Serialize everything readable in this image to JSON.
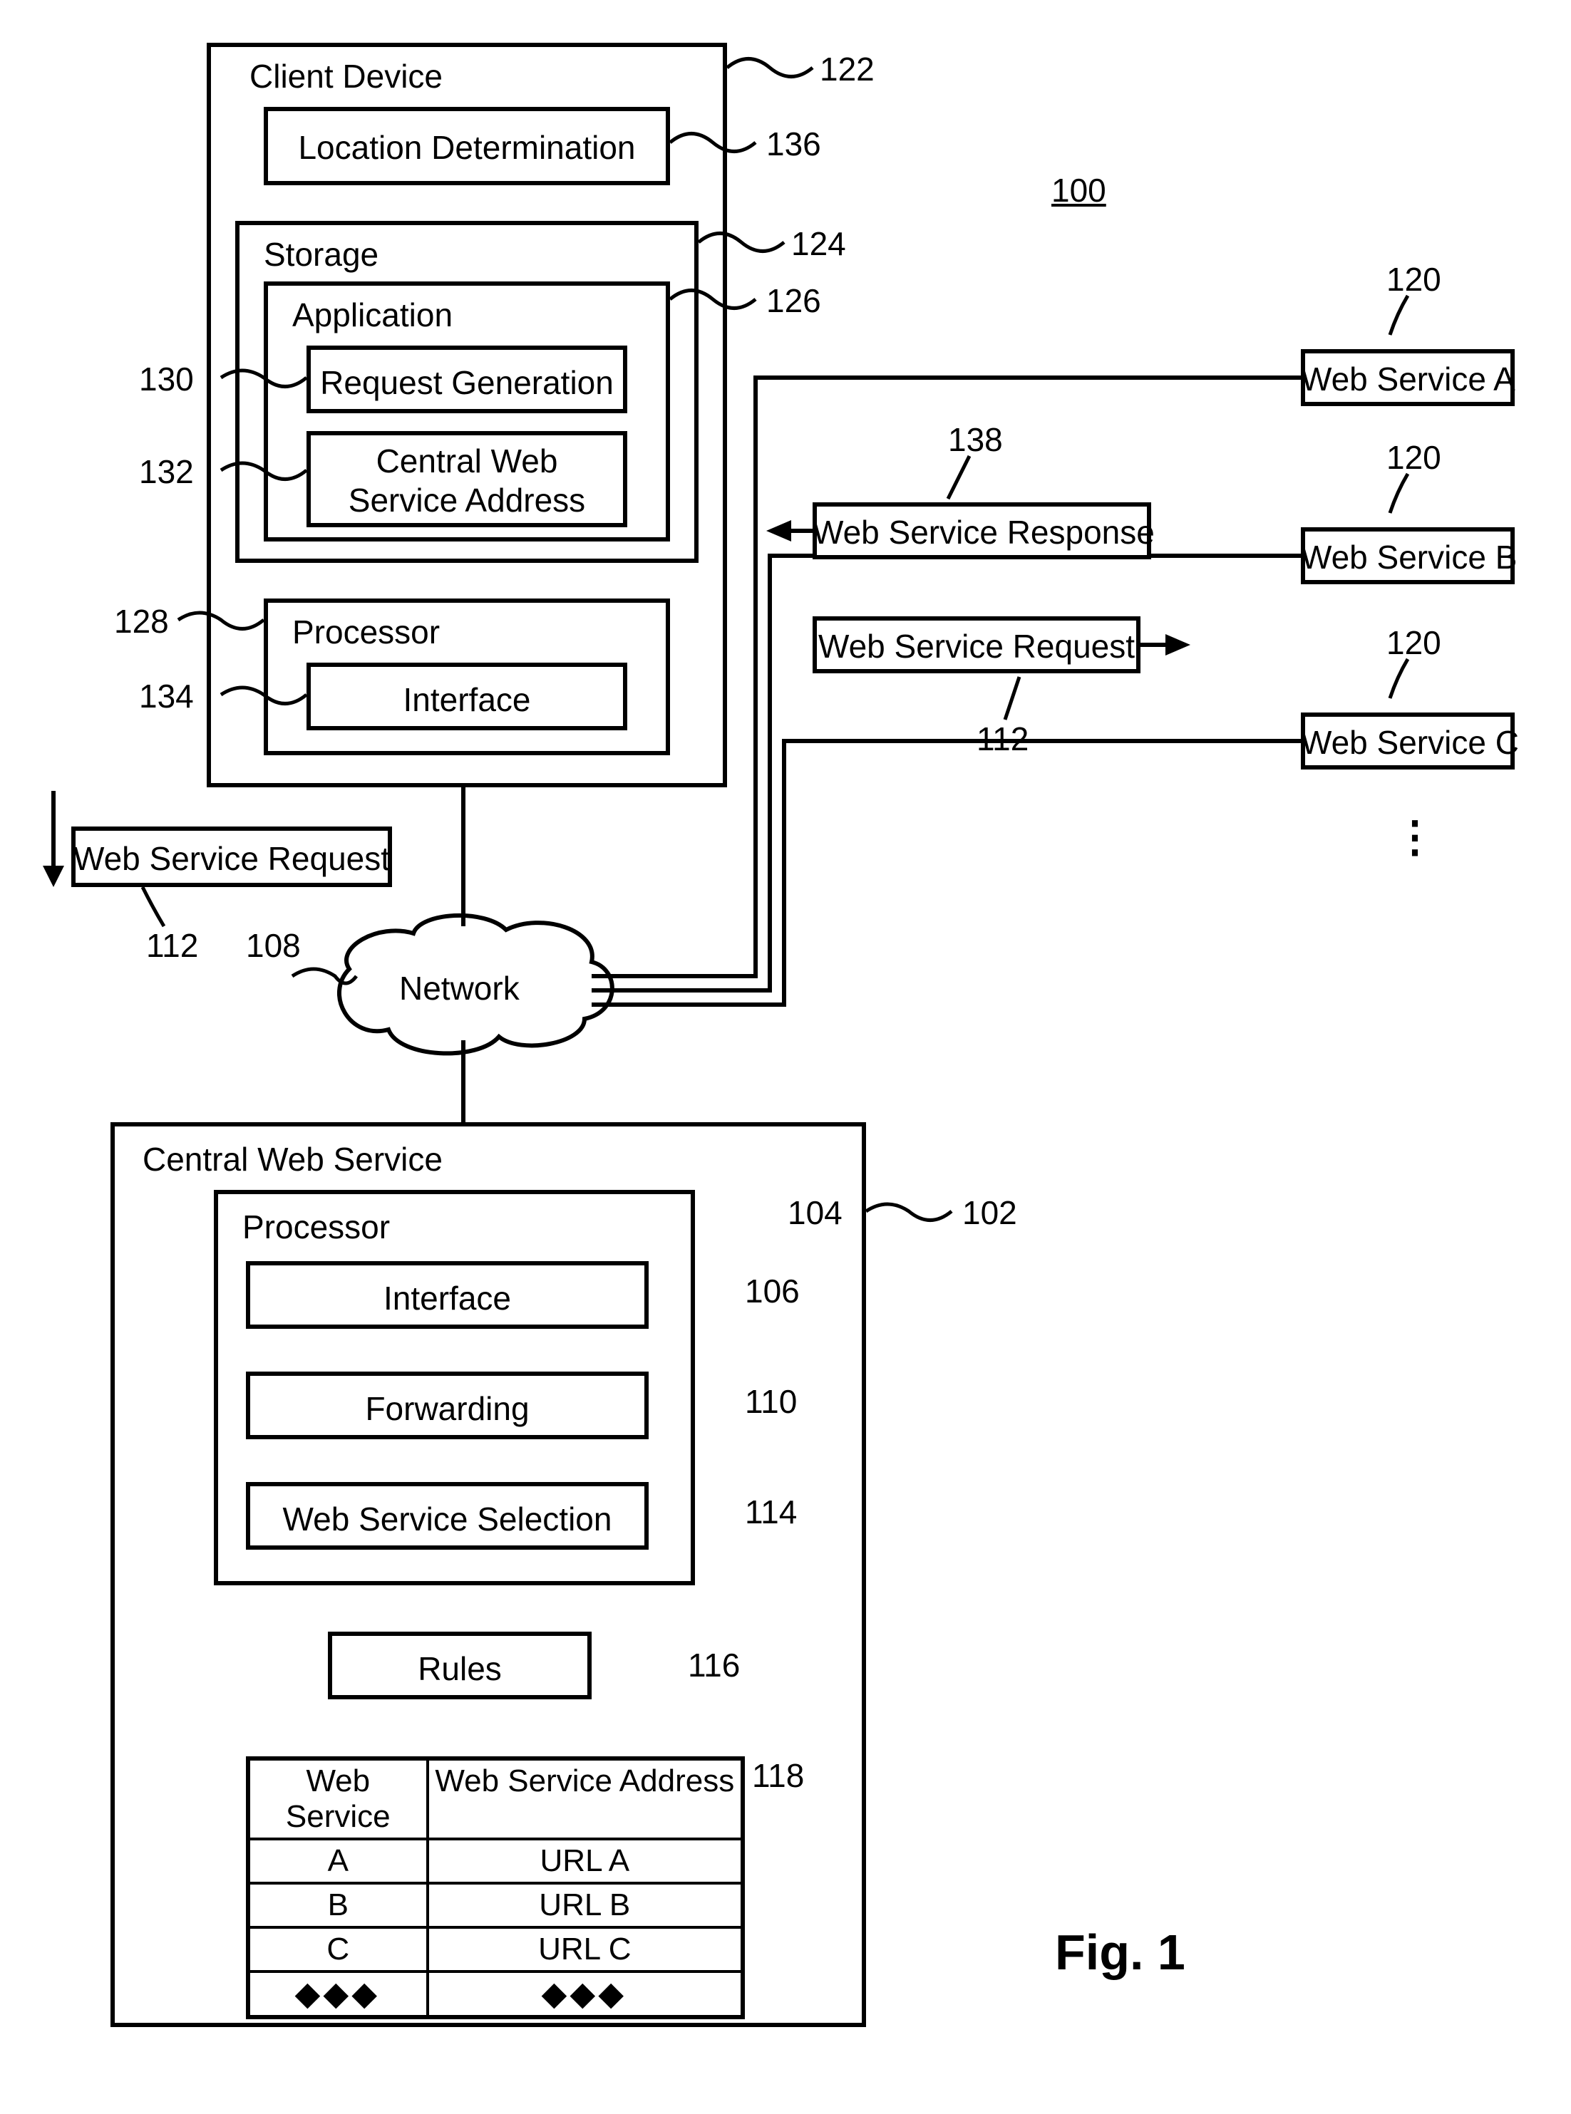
{
  "figure_ref": "100",
  "figure_caption": "Fig. 1",
  "client_device": {
    "title": "Client Device",
    "ref": "122",
    "location_determination": {
      "label": "Location Determination",
      "ref": "136"
    },
    "storage": {
      "title": "Storage",
      "ref": "124",
      "application": {
        "title": "Application",
        "ref": "126",
        "request_generation": {
          "label": "Request Generation",
          "ref": "130"
        },
        "central_web_service_address": {
          "label_line1": "Central Web",
          "label_line2": "Service Address",
          "ref": "132"
        }
      }
    },
    "processor": {
      "title": "Processor",
      "ref": "128",
      "interface": {
        "label": "Interface",
        "ref": "134"
      }
    }
  },
  "outgoing_request": {
    "label": "Web Service Request",
    "ref": "112"
  },
  "network": {
    "label": "Network",
    "ref": "108"
  },
  "central_web_service": {
    "title": "Central Web Service",
    "ref": "102",
    "processor": {
      "title": "Processor",
      "ref": "104",
      "interface": {
        "label": "Interface",
        "ref": "106"
      },
      "forwarding": {
        "label": "Forwarding",
        "ref": "110"
      },
      "web_service_selection": {
        "label": "Web Service Selection",
        "ref": "114"
      }
    },
    "rules": {
      "label": "Rules",
      "ref": "116"
    },
    "table": {
      "ref": "118",
      "header": {
        "c1": "Web Service",
        "c2": "Web Service Address"
      },
      "rows": [
        {
          "c1": "A",
          "c2": "URL A"
        },
        {
          "c1": "B",
          "c2": "URL B"
        },
        {
          "c1": "C",
          "c2": "URL C"
        },
        {
          "c1": "◆◆◆",
          "c2": "◆◆◆"
        }
      ]
    }
  },
  "web_services": {
    "ref": "120",
    "a": "Web Service A",
    "b": "Web Service B",
    "c": "Web Service C"
  },
  "messages": {
    "response": {
      "label": "Web Service Response",
      "ref": "138"
    },
    "request_to_service": {
      "label": "Web Service Request",
      "ref": "112"
    }
  }
}
